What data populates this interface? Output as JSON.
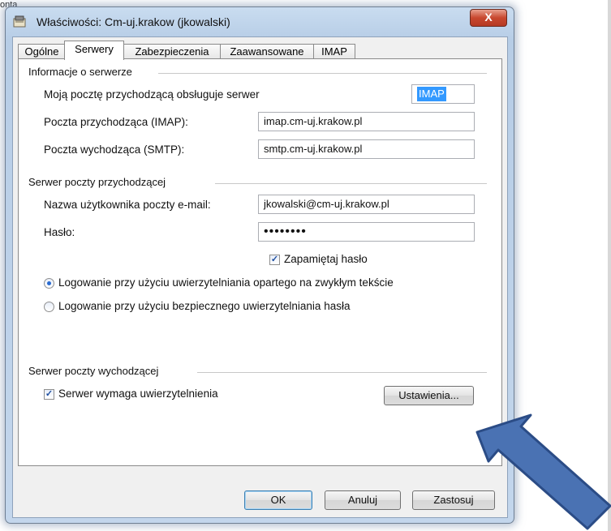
{
  "background": {
    "corner_text": "onta"
  },
  "window": {
    "title": "Właściwości: Cm-uj.krakow (jkowalski)",
    "close_label": "X"
  },
  "tabs": [
    {
      "label": "Ogólne",
      "active": false
    },
    {
      "label": "Serwery",
      "active": true
    },
    {
      "label": "Zabezpieczenia",
      "active": false
    },
    {
      "label": "Zaawansowane",
      "active": false
    },
    {
      "label": "IMAP",
      "active": false
    }
  ],
  "server_info": {
    "heading": "Informacje o serwerze",
    "incoming_type_label": "Moją pocztę przychodzącą obsługuje serwer",
    "incoming_type_value": "IMAP",
    "incoming_label": "Poczta przychodząca (IMAP):",
    "incoming_value": "imap.cm-uj.krakow.pl",
    "outgoing_label": "Poczta wychodząca (SMTP):",
    "outgoing_value": "smtp.cm-uj.krakow.pl"
  },
  "incoming_server": {
    "heading": "Serwer poczty przychodzącej",
    "username_label": "Nazwa użytkownika poczty e-mail:",
    "username_value": "jkowalski@cm-uj.krakow.pl",
    "password_label": "Hasło:",
    "password_value": "••••••••",
    "remember_label": "Zapamiętaj hasło",
    "remember_checked": true,
    "login_plain_label": "Logowanie przy użyciu uwierzytelniania opartego na zwykłym tekście",
    "login_secure_label": "Logowanie przy użyciu bezpiecznego uwierzytelniania hasła",
    "selected_login": "plain"
  },
  "outgoing_server": {
    "heading": "Serwer poczty wychodzącej",
    "auth_label": "Serwer wymaga uwierzytelnienia",
    "auth_checked": true,
    "settings_button": "Ustawienia..."
  },
  "buttons": {
    "ok": "OK",
    "cancel": "Anuluj",
    "apply": "Zastosuj"
  },
  "colors": {
    "arrow": "#4a72b3",
    "selection": "#3399ff"
  },
  "icons": {
    "title": "mail-account-icon",
    "check": "checkmark"
  }
}
